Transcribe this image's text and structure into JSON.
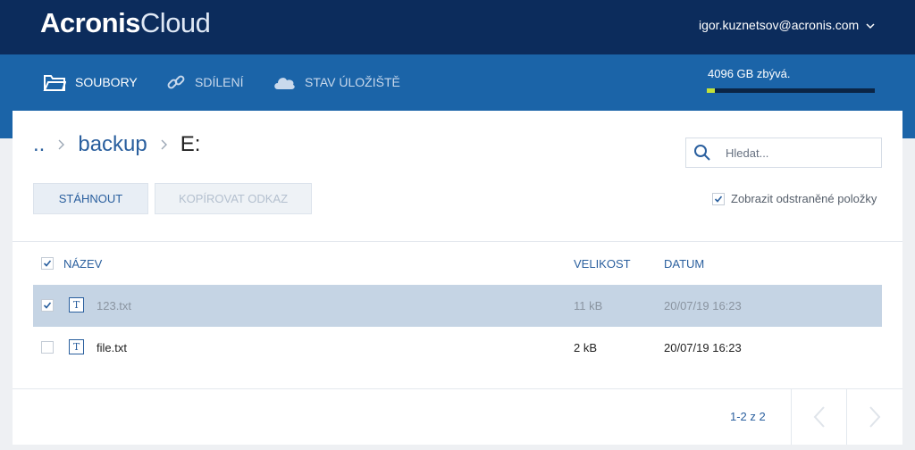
{
  "app": {
    "logo_main": "Acronis",
    "logo_sub": "Cloud"
  },
  "user": {
    "email": "igor.kuznetsov@acronis.com"
  },
  "nav": {
    "items": [
      {
        "label": "SOUBORY",
        "icon": "folder-icon",
        "active": true
      },
      {
        "label": "SDÍLENÍ",
        "icon": "link-icon",
        "active": false
      },
      {
        "label": "STAV ÚLOŽIŠTĚ",
        "icon": "cloud-icon",
        "active": false
      }
    ]
  },
  "storage": {
    "text": "4096 GB zbývá.",
    "used_fraction": 0.05
  },
  "breadcrumb": {
    "items": [
      "..",
      "backup"
    ],
    "current": "E:"
  },
  "search": {
    "placeholder": "Hledat..."
  },
  "toolbar": {
    "download_label": "STÁHNOUT",
    "copy_link_label": "KOPÍROVAT ODKAZ"
  },
  "show_deleted": {
    "label": "Zobrazit odstraněné položky",
    "checked": true
  },
  "table": {
    "headers": {
      "name": "NÁZEV",
      "size": "VELIKOST",
      "date": "DATUM"
    },
    "rows": [
      {
        "name": "123.txt",
        "size": "11 kB",
        "date": "20/07/19 16:23",
        "selected": true,
        "icon": "text-file-icon"
      },
      {
        "name": "file.txt",
        "size": "2 kB",
        "date": "20/07/19 16:23",
        "selected": false,
        "icon": "text-file-icon"
      }
    ]
  },
  "pagination": {
    "text": "1-2 z 2"
  },
  "colors": {
    "topbar": "#0c2c5c",
    "navbar": "#1b64a8",
    "accent": "#2a5f9e",
    "storage_fill": "#c3e23a"
  }
}
